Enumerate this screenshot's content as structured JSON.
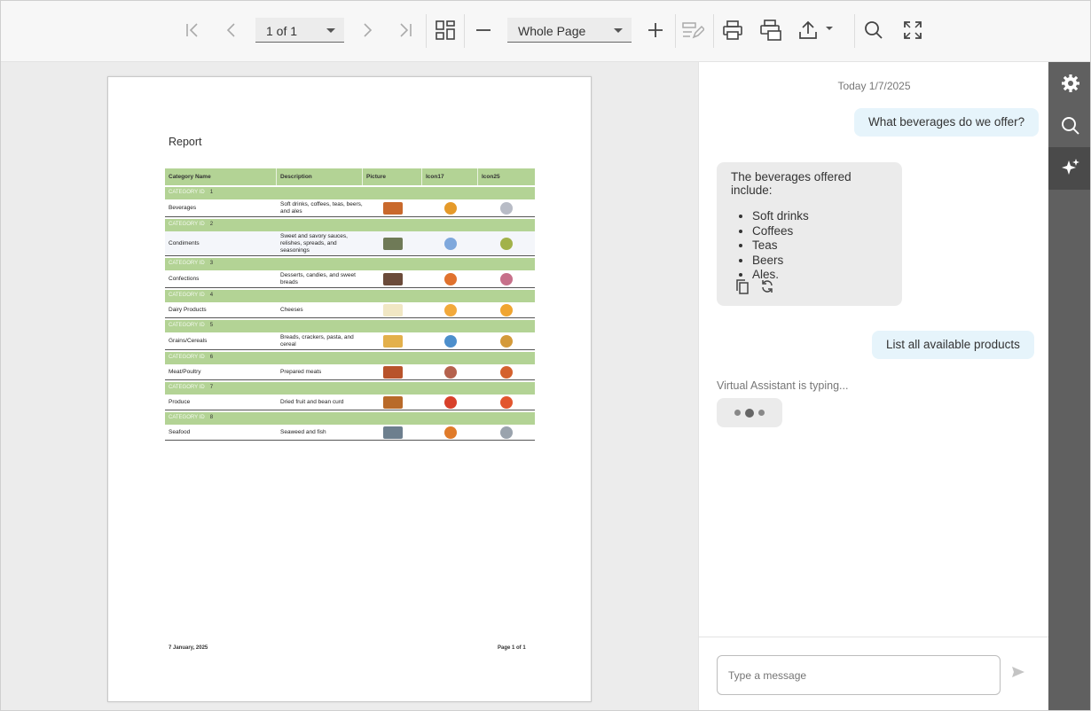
{
  "toolbar": {
    "page_selector": "1 of 1",
    "zoom_selector": "Whole Page",
    "icons": [
      "first-page-icon",
      "prev-page-icon",
      "next-page-icon",
      "last-page-icon",
      "multipage-icon",
      "zoom-out-icon",
      "zoom-in-icon",
      "editing-fields-icon",
      "print-icon",
      "print-page-icon",
      "export-icon",
      "search-icon",
      "fullscreen-icon"
    ]
  },
  "report": {
    "title": "Report",
    "columns": [
      "Category Name",
      "Description",
      "Picture",
      "Icon17",
      "Icon25"
    ],
    "group_label": "CATEGORY ID",
    "rows": [
      {
        "id": "1",
        "name": "Beverages",
        "description": "Soft drinks, coffees, teas, beers, and ales",
        "colors": [
          "#c9692c",
          "#e59a2a",
          "#b8bcc6"
        ]
      },
      {
        "id": "2",
        "name": "Condiments",
        "description": "Sweet and savory sauces, relishes, spreads, and seasonings",
        "colors": [
          "#6f7a57",
          "#7fa8dc",
          "#a2b24a"
        ]
      },
      {
        "id": "3",
        "name": "Confections",
        "description": "Desserts, candies, and sweet breads",
        "colors": [
          "#6b4b3a",
          "#e0722e",
          "#c7708a"
        ]
      },
      {
        "id": "4",
        "name": "Dairy Products",
        "description": "Cheeses",
        "colors": [
          "#f1e7c4",
          "#f2a93b",
          "#f0a531"
        ]
      },
      {
        "id": "5",
        "name": "Grains/Cereals",
        "description": "Breads, crackers, pasta, and cereal",
        "colors": [
          "#e3b04b",
          "#4d8fcc",
          "#d49a3a"
        ]
      },
      {
        "id": "6",
        "name": "Meat/Poultry",
        "description": "Prepared meats",
        "colors": [
          "#b8532b",
          "#b5624d",
          "#d4612e"
        ]
      },
      {
        "id": "7",
        "name": "Produce",
        "description": "Dried fruit and bean curd",
        "colors": [
          "#b86a2a",
          "#d8402a",
          "#e2552e"
        ]
      },
      {
        "id": "8",
        "name": "Seafood",
        "description": "Seaweed and fish",
        "colors": [
          "#6d7f8e",
          "#e07b2a",
          "#9aa3ad"
        ]
      }
    ],
    "footer_date": "7 January, 2025",
    "footer_page": "Page 1 of 1"
  },
  "chat": {
    "date": "Today 1/7/2025",
    "user_message_1": "What beverages do we offer?",
    "bot_intro": "The beverages offered include:",
    "bot_items": [
      "Soft drinks",
      "Coffees",
      "Teas",
      "Beers",
      "Ales."
    ],
    "user_message_2": "List all available products",
    "typing": "Virtual Assistant is typing...",
    "input_placeholder": "Type a message"
  },
  "colors": {
    "table_header": "#b3d395",
    "chat_user_bubble": "#e6f4fb",
    "rail": "#606060"
  }
}
